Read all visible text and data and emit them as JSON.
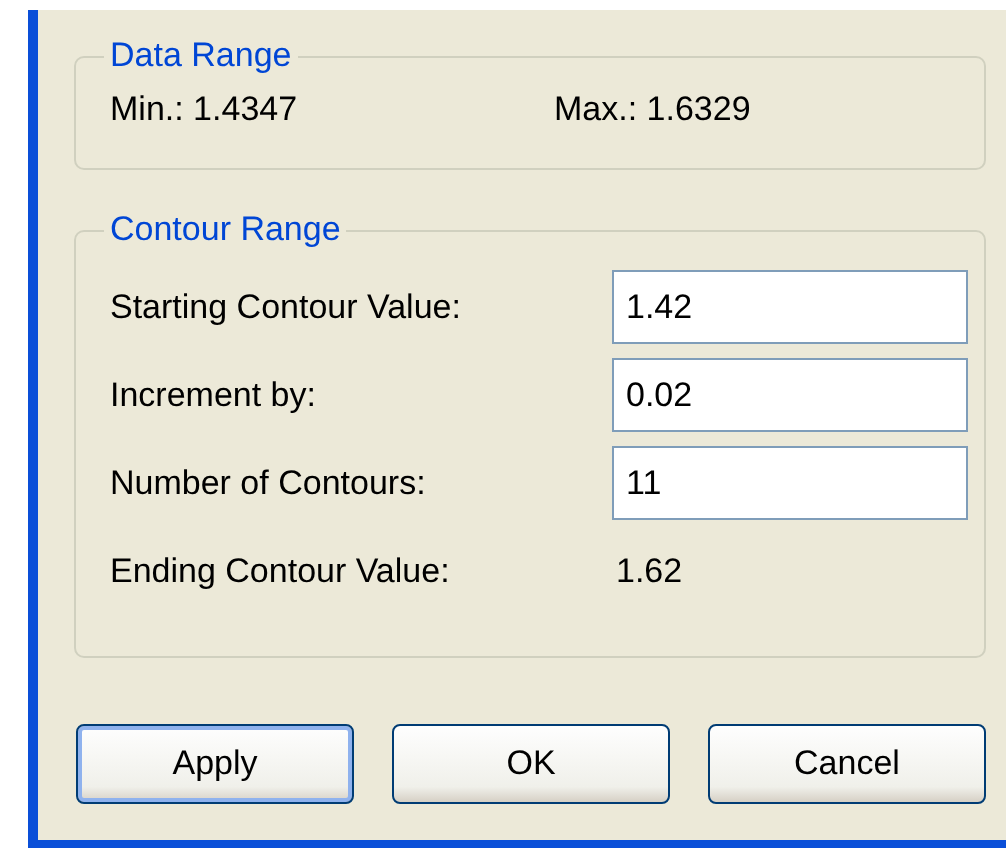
{
  "data_range": {
    "title": "Data Range",
    "min": "Min.: 1.4347",
    "max": "Max.: 1.6329"
  },
  "contour_range": {
    "title": "Contour Range",
    "rows": [
      {
        "kind": "input",
        "label": "Starting Contour Value:",
        "value": "1.42"
      },
      {
        "kind": "input",
        "label": "Increment by:",
        "value": "0.02"
      },
      {
        "kind": "input",
        "label": "Number of Contours:",
        "value": "11"
      },
      {
        "kind": "readout",
        "label": "Ending Contour Value:",
        "value": "1.62"
      }
    ]
  },
  "buttons": [
    {
      "label": "Apply",
      "default": true
    },
    {
      "label": "OK",
      "default": false
    },
    {
      "label": "Cancel",
      "default": false
    }
  ]
}
